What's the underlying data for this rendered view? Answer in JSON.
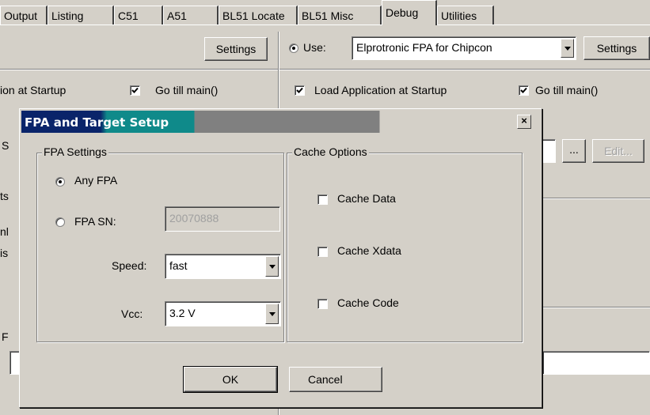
{
  "tabs": [
    {
      "label": "Output"
    },
    {
      "label": "Listing"
    },
    {
      "label": "C51"
    },
    {
      "label": "A51"
    },
    {
      "label": "BL51 Locate"
    },
    {
      "label": "BL51 Misc"
    },
    {
      "label": "Debug"
    },
    {
      "label": "Utilities"
    }
  ],
  "left_panel": {
    "settings_label": "Settings",
    "load_app_partial": "ion at Startup",
    "go_till_main": "Go  till main()",
    "hidden_fragments": [
      "S",
      "ts",
      "nl",
      "is",
      "F"
    ]
  },
  "right_panel": {
    "use_label": "Use:",
    "driver_value": "Elprotronic FPA for Chipcon",
    "settings_label": "Settings",
    "load_app": "Load Application at Startup",
    "go_till_main": "Go  till main()",
    "browse_label": "...",
    "edit_label": "Edit..."
  },
  "dialog": {
    "title": "FPA and Target Setup",
    "close_glyph": "×",
    "fpa_settings": {
      "title": "FPA Settings",
      "any_fpa_label": "Any FPA",
      "fpa_sn_label": "FPA SN:",
      "fpa_sn_value": "20070888",
      "speed_label": "Speed:",
      "speed_value": "fast",
      "vcc_label": "Vcc:",
      "vcc_value": "3.2 V"
    },
    "cache_options": {
      "title": "Cache Options",
      "cache_data": "Cache Data",
      "cache_xdata": "Cache Xdata",
      "cache_code": "Cache Code"
    },
    "ok_label": "OK",
    "cancel_label": "Cancel"
  }
}
